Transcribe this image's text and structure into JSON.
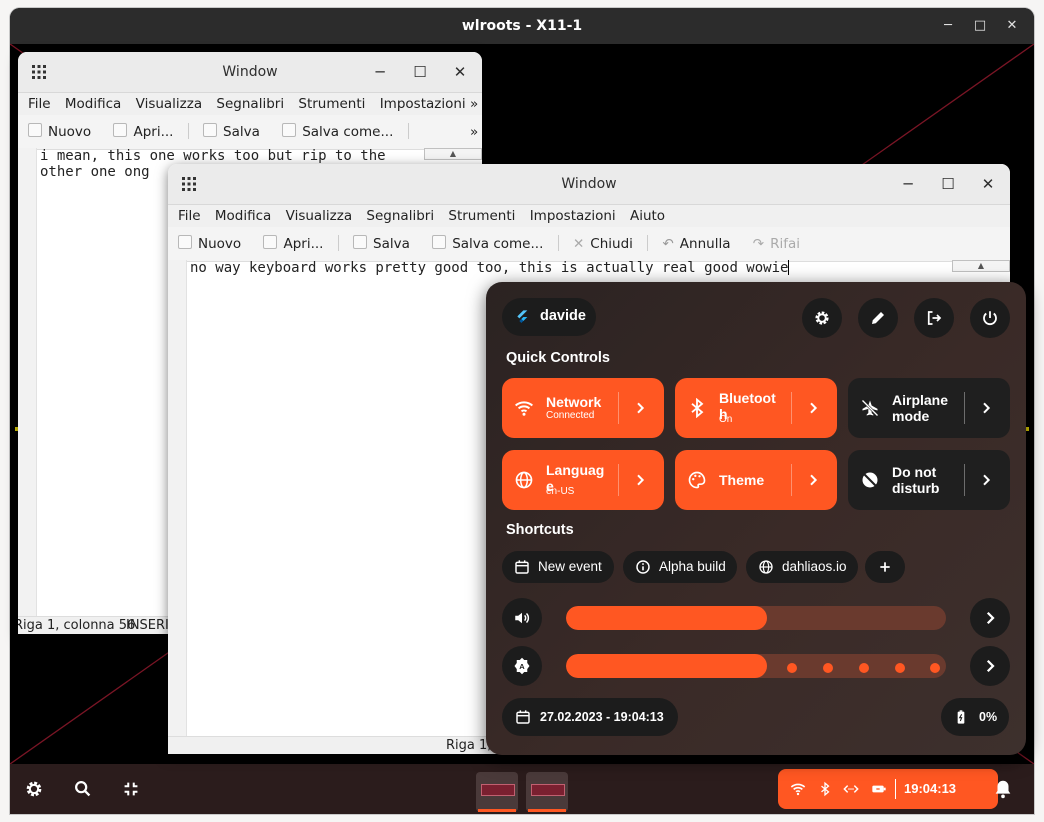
{
  "outer_window": {
    "title": "wlroots - X11-1"
  },
  "editor_back": {
    "title": "Window",
    "menu": [
      "File",
      "Modifica",
      "Visualizza",
      "Segnalibri",
      "Strumenti",
      "Impostazioni"
    ],
    "menu_overflow": "»",
    "toolbar": [
      "Nuovo",
      "Apri...",
      "Salva",
      "Salva come..."
    ],
    "toolbar_overflow": "»",
    "text_line1": "i mean, this one works too but rip to the",
    "text_line2": "other one ong",
    "status": "Riga 1, colonna 56",
    "status_mode": "INSERI"
  },
  "editor_front": {
    "title": "Window",
    "menu": [
      "File",
      "Modifica",
      "Visualizza",
      "Segnalibri",
      "Strumenti",
      "Impostazioni",
      "Aiuto"
    ],
    "toolbar": [
      "Nuovo",
      "Apri...",
      "Salva",
      "Salva come...",
      "Chiudi",
      "Annulla",
      "Rifai"
    ],
    "text": "no way keyboard works pretty good too, this is actually real good wowie",
    "status": "Riga 1,"
  },
  "quick_panel": {
    "user": "davide",
    "quick_controls_title": "Quick Controls",
    "tiles": [
      {
        "name": "Network",
        "sub": "Connected",
        "icon": "wifi-icon",
        "active": true
      },
      {
        "name": "Bluetooth",
        "sub": "On",
        "icon": "bluetooth-icon",
        "active": true
      },
      {
        "name": "Airplane mode",
        "sub": "",
        "icon": "airplane-off-icon",
        "active": false
      },
      {
        "name": "Language",
        "sub": "en-US",
        "icon": "globe-icon",
        "active": true
      },
      {
        "name": "Theme",
        "sub": "",
        "icon": "palette-icon",
        "active": true
      },
      {
        "name": "Do not disturb",
        "sub": "",
        "icon": "do-not-disturb-icon",
        "active": false
      }
    ],
    "shortcuts_title": "Shortcuts",
    "shortcuts": [
      "New event",
      "Alpha build",
      "dahliaos.io"
    ],
    "volume_level": 0.53,
    "brightness_level": 0.53,
    "date_time": "27.02.2023 - 19:04:13",
    "battery": "0%"
  },
  "taskbar": {
    "clock": "19:04:13"
  },
  "colors": {
    "accent": "#ff5722",
    "panel_bg": "#2e2423",
    "taskbar_bg": "#2b1c1c"
  }
}
